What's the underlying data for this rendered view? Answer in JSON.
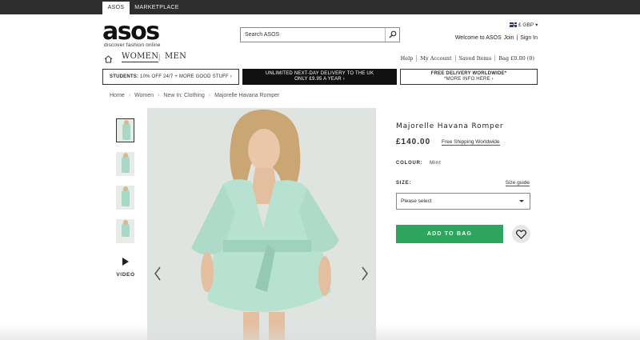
{
  "topbar": {
    "tab_asos": "ASOS",
    "tab_marketplace": "MARKETPLACE"
  },
  "header": {
    "logo": "asos",
    "tagline": "discover fashion online",
    "search_placeholder": "Search ASOS",
    "currency": "£ GBP",
    "welcome": "Welcome to ASOS",
    "join": "Join",
    "separator": "|",
    "sign_in": "Sign In"
  },
  "nav": {
    "women": "WOMEN",
    "divider": "|",
    "men": "MEN",
    "links": [
      "Help",
      "My Account",
      "Saved Items",
      "Bag £0.00 (0)"
    ]
  },
  "promos": {
    "p1_bold": "STUDENTS:",
    "p1_text": "10% OFF 24/7 + MORE GOOD STUFF ›",
    "p2_line1": "UNLIMITED NEXT-DAY DELIVERY TO THE UK",
    "p2_line2": "ONLY £9.95 A YEAR ›",
    "p3_line1": "FREE DELIVERY WORLDWIDE*",
    "p3_line2": "*MORE INFO HERE ›"
  },
  "breadcrumb": [
    "Home",
    "Women",
    "New In: Clothing",
    "Majorelle Havana Romper"
  ],
  "breadcrumb_sep": "›",
  "gallery": {
    "video_label": "VIDEO"
  },
  "product": {
    "name": "Majorelle Havana Romper",
    "price": "£140.00",
    "shipping": "Free Shipping Worldwide",
    "colour_label": "COLOUR:",
    "colour_value": "Mint",
    "size_label": "SIZE:",
    "size_guide": "Size guide",
    "size_select": "Please select",
    "add_to_bag": "ADD TO BAG"
  },
  "colors": {
    "add_button": "#2ea55f",
    "topbar": "#2d2d2d",
    "product_mint": "#a8d9c6"
  }
}
